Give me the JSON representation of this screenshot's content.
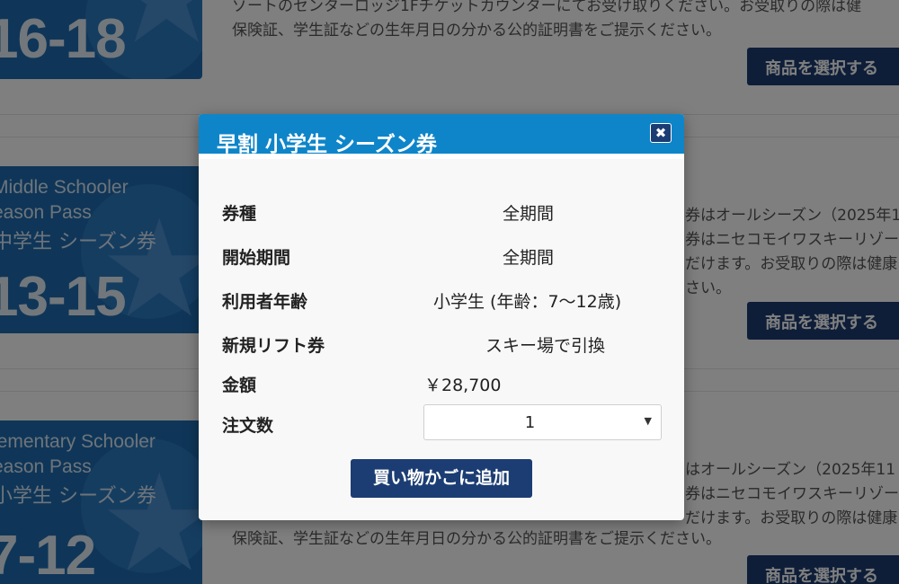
{
  "background": {
    "cards": [
      {
        "name_en": "",
        "pass_en": "",
        "name_ja": "",
        "age": "16-18",
        "desc_lines": [
          "ゾートのセンターロッジ1Fチケットカウンターにてお受け取りください。お受取りの際は健",
          "保険証、学生証などの生年月日の分かる公的証明書をご提示ください。"
        ],
        "button_label": "商品を選択する"
      },
      {
        "name_en": "Middle Schooler",
        "pass_en": "eason Pass",
        "name_ja": "中学生 シーズン券",
        "age": "13-15",
        "desc_lines": [
          "券はオールシーズン（2025年1",
          "券はニセコモイワスキーリゾー",
          "だけます。お受取りの際は健康",
          "さい。"
        ],
        "button_label": "商品を選択する"
      },
      {
        "name_en": "lementary Schooler",
        "pass_en": "eason Pass",
        "name_ja": "小学生 シーズン券",
        "age": "7-12",
        "desc_lines": [
          "はオールシーズン（2025年11",
          "券はニセコモイワスキーリゾー",
          "だけます。お受取りの際は健康",
          "保険証、学生証などの生年月日の分かる公的証明書をご提示ください。"
        ],
        "button_label": "商品を選択する"
      }
    ]
  },
  "modal": {
    "title": "早割 小学生 シーズン券",
    "close_glyph": "✖",
    "rows": [
      {
        "label": "券種",
        "value": "全期間"
      },
      {
        "label": "開始期間",
        "value": "全期間"
      },
      {
        "label": "利用者年齢",
        "value": "小学生 (年齢：7〜12歳)"
      },
      {
        "label": "新規リフト券",
        "value": "スキー場で引換"
      },
      {
        "label": "金額",
        "value": "￥28,700"
      },
      {
        "label": "注文数",
        "value": ""
      }
    ],
    "quantity": {
      "selected": "1"
    },
    "add_to_cart_label": "買い物かごに追加"
  }
}
